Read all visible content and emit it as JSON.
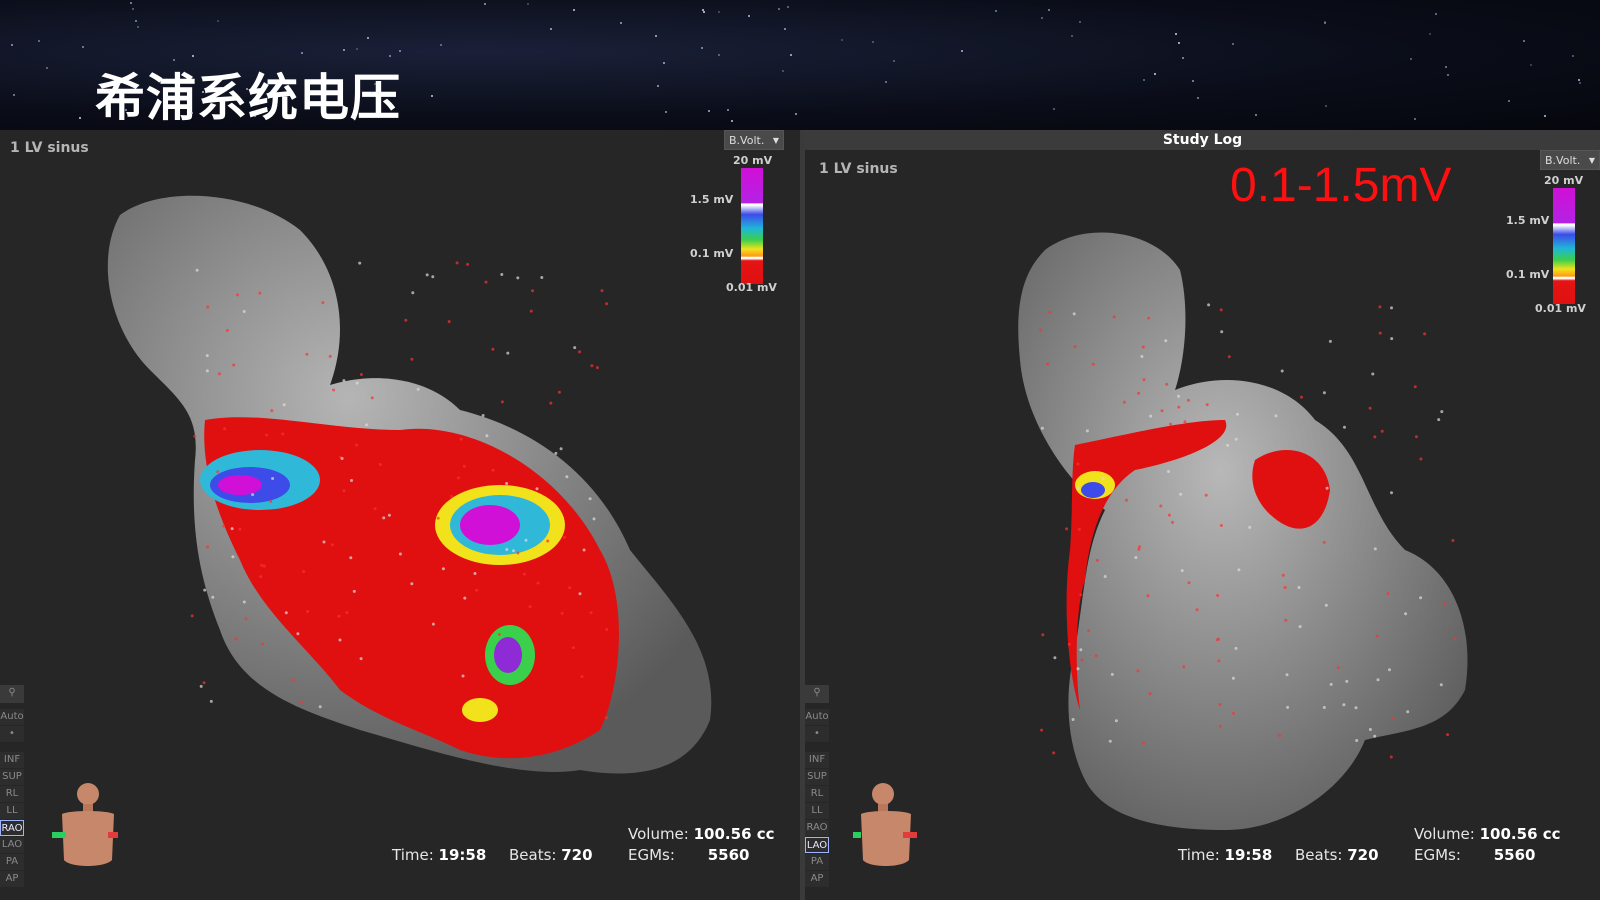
{
  "slide": {
    "title": "希浦系统电压"
  },
  "left_panel": {
    "map_label": "1 LV sinus",
    "dropdown": "B.Volt.",
    "scale": {
      "top": "20 mV",
      "upper": "1.5 mV",
      "lower": "0.1 mV",
      "bottom": "0.01 mV"
    },
    "tools": [
      "Auto",
      "•",
      "INF",
      "SUP",
      "RL",
      "LL",
      "RAO",
      "LAO",
      "PA",
      "AP"
    ],
    "selected_view": "RAO",
    "stats": {
      "time_label": "Time:",
      "time": "19:58",
      "beats_label": "Beats:",
      "beats": "720",
      "volume_label": "Volume:",
      "volume": "100.56 cc",
      "egms_label": "EGMs:",
      "egms": "5560"
    }
  },
  "right_panel": {
    "window_title": "Study Log",
    "map_label": "1 LV sinus",
    "voltage_note": "0.1-1.5mV",
    "dropdown": "B.Volt.",
    "scale": {
      "top": "20 mV",
      "upper": "1.5 mV",
      "lower": "0.1 mV",
      "bottom": "0.01 mV"
    },
    "tools": [
      "Auto",
      "•",
      "INF",
      "SUP",
      "RL",
      "LL",
      "RAO",
      "LAO",
      "PA",
      "AP"
    ],
    "selected_view": "LAO",
    "stats": {
      "time_label": "Time:",
      "time": "19:58",
      "beats_label": "Beats:",
      "beats": "720",
      "volume_label": "Volume:",
      "volume": "100.56 cc",
      "egms_label": "EGMs:",
      "egms": "5560"
    }
  },
  "colors": {
    "low_voltage": "#e01010",
    "normal_voltage": "#d010d6",
    "tissue": "#8e8e8e"
  }
}
